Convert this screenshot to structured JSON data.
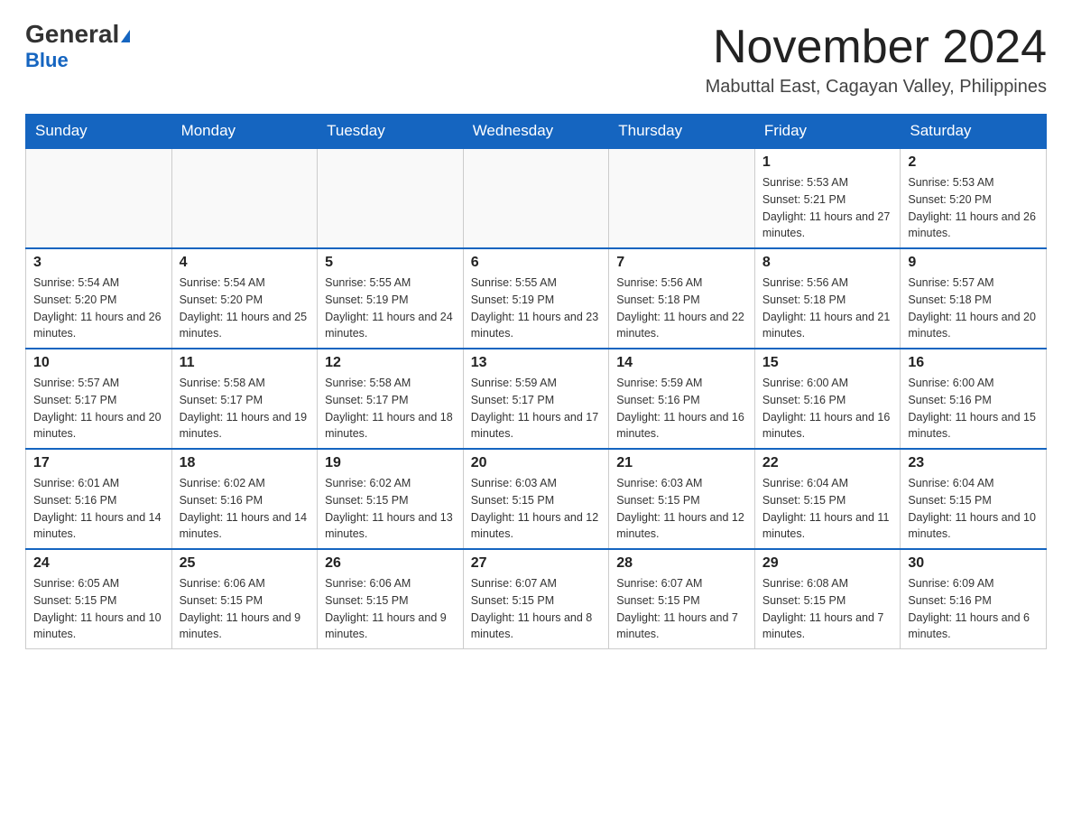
{
  "header": {
    "logo_general": "General",
    "logo_blue": "Blue",
    "month_title": "November 2024",
    "location": "Mabuttal East, Cagayan Valley, Philippines"
  },
  "days_of_week": [
    "Sunday",
    "Monday",
    "Tuesday",
    "Wednesday",
    "Thursday",
    "Friday",
    "Saturday"
  ],
  "weeks": [
    [
      {
        "day": "",
        "sunrise": "",
        "sunset": "",
        "daylight": ""
      },
      {
        "day": "",
        "sunrise": "",
        "sunset": "",
        "daylight": ""
      },
      {
        "day": "",
        "sunrise": "",
        "sunset": "",
        "daylight": ""
      },
      {
        "day": "",
        "sunrise": "",
        "sunset": "",
        "daylight": ""
      },
      {
        "day": "",
        "sunrise": "",
        "sunset": "",
        "daylight": ""
      },
      {
        "day": "1",
        "sunrise": "Sunrise: 5:53 AM",
        "sunset": "Sunset: 5:21 PM",
        "daylight": "Daylight: 11 hours and 27 minutes."
      },
      {
        "day": "2",
        "sunrise": "Sunrise: 5:53 AM",
        "sunset": "Sunset: 5:20 PM",
        "daylight": "Daylight: 11 hours and 26 minutes."
      }
    ],
    [
      {
        "day": "3",
        "sunrise": "Sunrise: 5:54 AM",
        "sunset": "Sunset: 5:20 PM",
        "daylight": "Daylight: 11 hours and 26 minutes."
      },
      {
        "day": "4",
        "sunrise": "Sunrise: 5:54 AM",
        "sunset": "Sunset: 5:20 PM",
        "daylight": "Daylight: 11 hours and 25 minutes."
      },
      {
        "day": "5",
        "sunrise": "Sunrise: 5:55 AM",
        "sunset": "Sunset: 5:19 PM",
        "daylight": "Daylight: 11 hours and 24 minutes."
      },
      {
        "day": "6",
        "sunrise": "Sunrise: 5:55 AM",
        "sunset": "Sunset: 5:19 PM",
        "daylight": "Daylight: 11 hours and 23 minutes."
      },
      {
        "day": "7",
        "sunrise": "Sunrise: 5:56 AM",
        "sunset": "Sunset: 5:18 PM",
        "daylight": "Daylight: 11 hours and 22 minutes."
      },
      {
        "day": "8",
        "sunrise": "Sunrise: 5:56 AM",
        "sunset": "Sunset: 5:18 PM",
        "daylight": "Daylight: 11 hours and 21 minutes."
      },
      {
        "day": "9",
        "sunrise": "Sunrise: 5:57 AM",
        "sunset": "Sunset: 5:18 PM",
        "daylight": "Daylight: 11 hours and 20 minutes."
      }
    ],
    [
      {
        "day": "10",
        "sunrise": "Sunrise: 5:57 AM",
        "sunset": "Sunset: 5:17 PM",
        "daylight": "Daylight: 11 hours and 20 minutes."
      },
      {
        "day": "11",
        "sunrise": "Sunrise: 5:58 AM",
        "sunset": "Sunset: 5:17 PM",
        "daylight": "Daylight: 11 hours and 19 minutes."
      },
      {
        "day": "12",
        "sunrise": "Sunrise: 5:58 AM",
        "sunset": "Sunset: 5:17 PM",
        "daylight": "Daylight: 11 hours and 18 minutes."
      },
      {
        "day": "13",
        "sunrise": "Sunrise: 5:59 AM",
        "sunset": "Sunset: 5:17 PM",
        "daylight": "Daylight: 11 hours and 17 minutes."
      },
      {
        "day": "14",
        "sunrise": "Sunrise: 5:59 AM",
        "sunset": "Sunset: 5:16 PM",
        "daylight": "Daylight: 11 hours and 16 minutes."
      },
      {
        "day": "15",
        "sunrise": "Sunrise: 6:00 AM",
        "sunset": "Sunset: 5:16 PM",
        "daylight": "Daylight: 11 hours and 16 minutes."
      },
      {
        "day": "16",
        "sunrise": "Sunrise: 6:00 AM",
        "sunset": "Sunset: 5:16 PM",
        "daylight": "Daylight: 11 hours and 15 minutes."
      }
    ],
    [
      {
        "day": "17",
        "sunrise": "Sunrise: 6:01 AM",
        "sunset": "Sunset: 5:16 PM",
        "daylight": "Daylight: 11 hours and 14 minutes."
      },
      {
        "day": "18",
        "sunrise": "Sunrise: 6:02 AM",
        "sunset": "Sunset: 5:16 PM",
        "daylight": "Daylight: 11 hours and 14 minutes."
      },
      {
        "day": "19",
        "sunrise": "Sunrise: 6:02 AM",
        "sunset": "Sunset: 5:15 PM",
        "daylight": "Daylight: 11 hours and 13 minutes."
      },
      {
        "day": "20",
        "sunrise": "Sunrise: 6:03 AM",
        "sunset": "Sunset: 5:15 PM",
        "daylight": "Daylight: 11 hours and 12 minutes."
      },
      {
        "day": "21",
        "sunrise": "Sunrise: 6:03 AM",
        "sunset": "Sunset: 5:15 PM",
        "daylight": "Daylight: 11 hours and 12 minutes."
      },
      {
        "day": "22",
        "sunrise": "Sunrise: 6:04 AM",
        "sunset": "Sunset: 5:15 PM",
        "daylight": "Daylight: 11 hours and 11 minutes."
      },
      {
        "day": "23",
        "sunrise": "Sunrise: 6:04 AM",
        "sunset": "Sunset: 5:15 PM",
        "daylight": "Daylight: 11 hours and 10 minutes."
      }
    ],
    [
      {
        "day": "24",
        "sunrise": "Sunrise: 6:05 AM",
        "sunset": "Sunset: 5:15 PM",
        "daylight": "Daylight: 11 hours and 10 minutes."
      },
      {
        "day": "25",
        "sunrise": "Sunrise: 6:06 AM",
        "sunset": "Sunset: 5:15 PM",
        "daylight": "Daylight: 11 hours and 9 minutes."
      },
      {
        "day": "26",
        "sunrise": "Sunrise: 6:06 AM",
        "sunset": "Sunset: 5:15 PM",
        "daylight": "Daylight: 11 hours and 9 minutes."
      },
      {
        "day": "27",
        "sunrise": "Sunrise: 6:07 AM",
        "sunset": "Sunset: 5:15 PM",
        "daylight": "Daylight: 11 hours and 8 minutes."
      },
      {
        "day": "28",
        "sunrise": "Sunrise: 6:07 AM",
        "sunset": "Sunset: 5:15 PM",
        "daylight": "Daylight: 11 hours and 7 minutes."
      },
      {
        "day": "29",
        "sunrise": "Sunrise: 6:08 AM",
        "sunset": "Sunset: 5:15 PM",
        "daylight": "Daylight: 11 hours and 7 minutes."
      },
      {
        "day": "30",
        "sunrise": "Sunrise: 6:09 AM",
        "sunset": "Sunset: 5:16 PM",
        "daylight": "Daylight: 11 hours and 6 minutes."
      }
    ]
  ]
}
